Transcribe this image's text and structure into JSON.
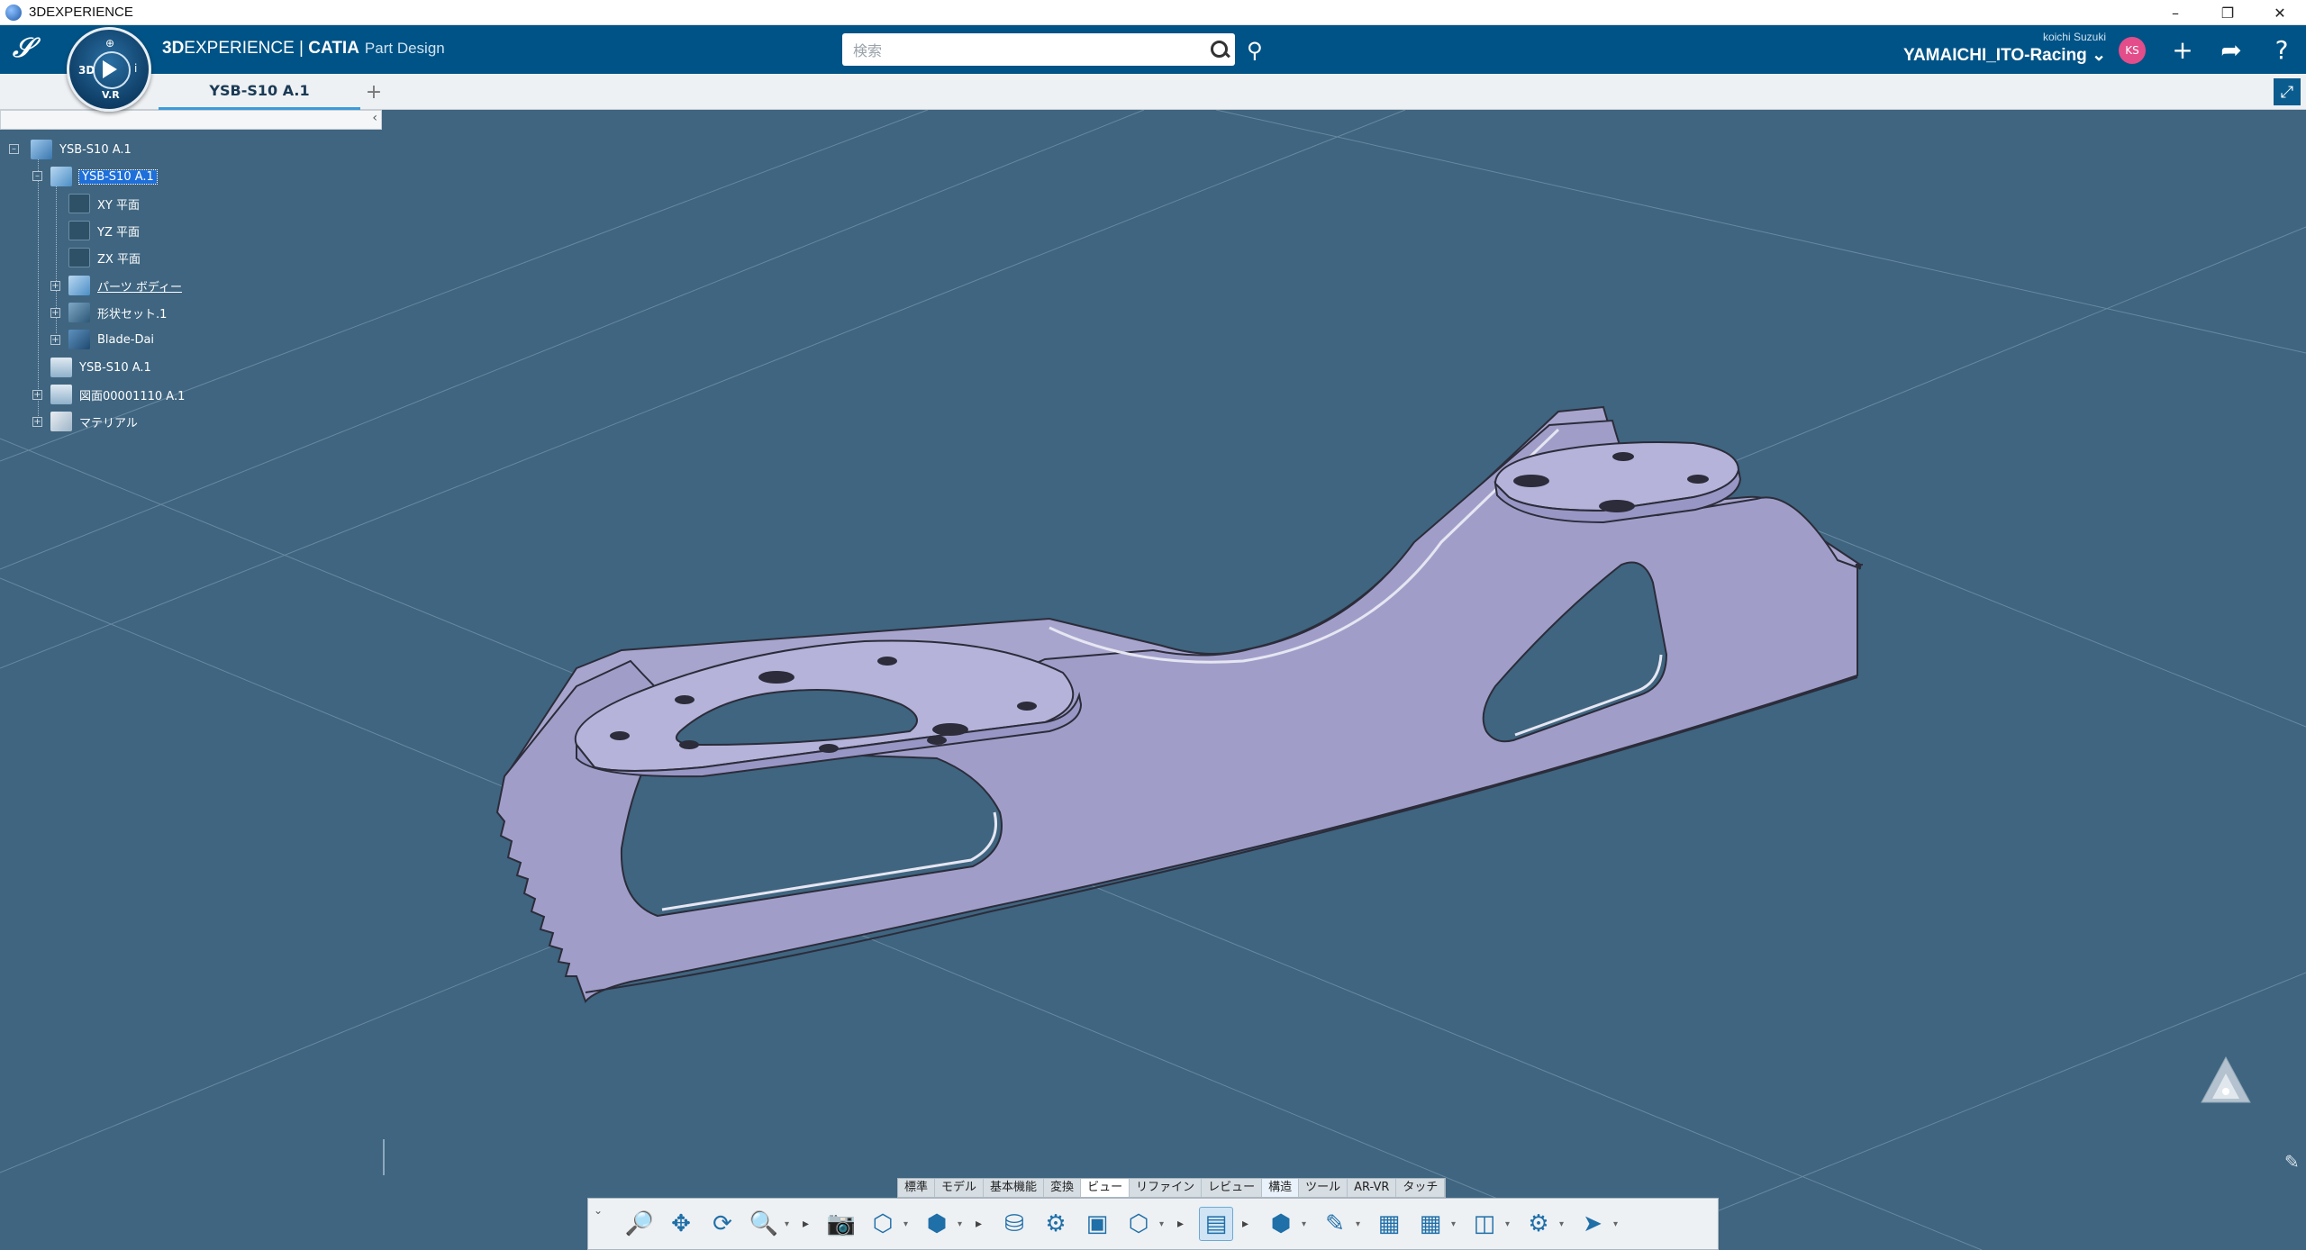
{
  "window": {
    "title": "3DEXPERIENCE"
  },
  "header": {
    "brand_bold": "3D",
    "brand_exp": "EXPERIENCE",
    "brand_sep": " | ",
    "brand_catia": "CATIA",
    "brand_app": "Part Design",
    "search_placeholder": "検索",
    "user_name": "koichi Suzuki",
    "tenant": "YAMAICHI_ITO-Racing",
    "avatar_initials": "KS",
    "compass_3d": "3D",
    "compass_vr": "V.R"
  },
  "tabs": [
    {
      "label": "YSB-S10 A.1"
    }
  ],
  "tree": [
    {
      "label": "YSB-S10 A.1",
      "icon": "product-icon"
    },
    {
      "label": "YSB-S10 A.1",
      "icon": "part-icon",
      "selected": true
    },
    {
      "label": "XY 平面",
      "icon": "plane-icon"
    },
    {
      "label": "YZ 平面",
      "icon": "plane-icon"
    },
    {
      "label": "ZX 平面",
      "icon": "plane-icon"
    },
    {
      "label": "パーツ ボディー",
      "icon": "body-icon"
    },
    {
      "label": "形状セット.1",
      "icon": "geometrical-set-icon"
    },
    {
      "label": "Blade-Dai",
      "icon": "sketch-icon"
    },
    {
      "label": "YSB-S10 A.1",
      "icon": "drawing-icon"
    },
    {
      "label": "図面00001110 A.1",
      "icon": "drawing-icon"
    },
    {
      "label": "マテリアル",
      "icon": "material-icon"
    }
  ],
  "section_tabs": [
    "標準",
    "モデル",
    "基本機能",
    "変換",
    "ビュー",
    "リファイン",
    "レビュー",
    "構造",
    "ツール",
    "AR-VR",
    "タッチ"
  ],
  "active_section": "ビュー",
  "actions": [
    "zoom-area-icon",
    "pan-icon",
    "rotate-icon",
    "zoom-icon",
    "capture-icon",
    "view-mode-icon",
    "cube-view-icon",
    "db-icon",
    "settings-icon",
    "render-icon",
    "wireframe-icon",
    "structure-icon",
    "solid-cube-icon",
    "sketch-view-icon",
    "assembly-icon",
    "mesh-icon",
    "section-icon",
    "snap-icon",
    "measure-icon"
  ],
  "colors": {
    "header_bg": "#005386",
    "viewport_bg": "#3f6580",
    "part_fill": "#a9a7cf",
    "part_top": "#b7b5db",
    "selection": "#1e6fd9"
  }
}
